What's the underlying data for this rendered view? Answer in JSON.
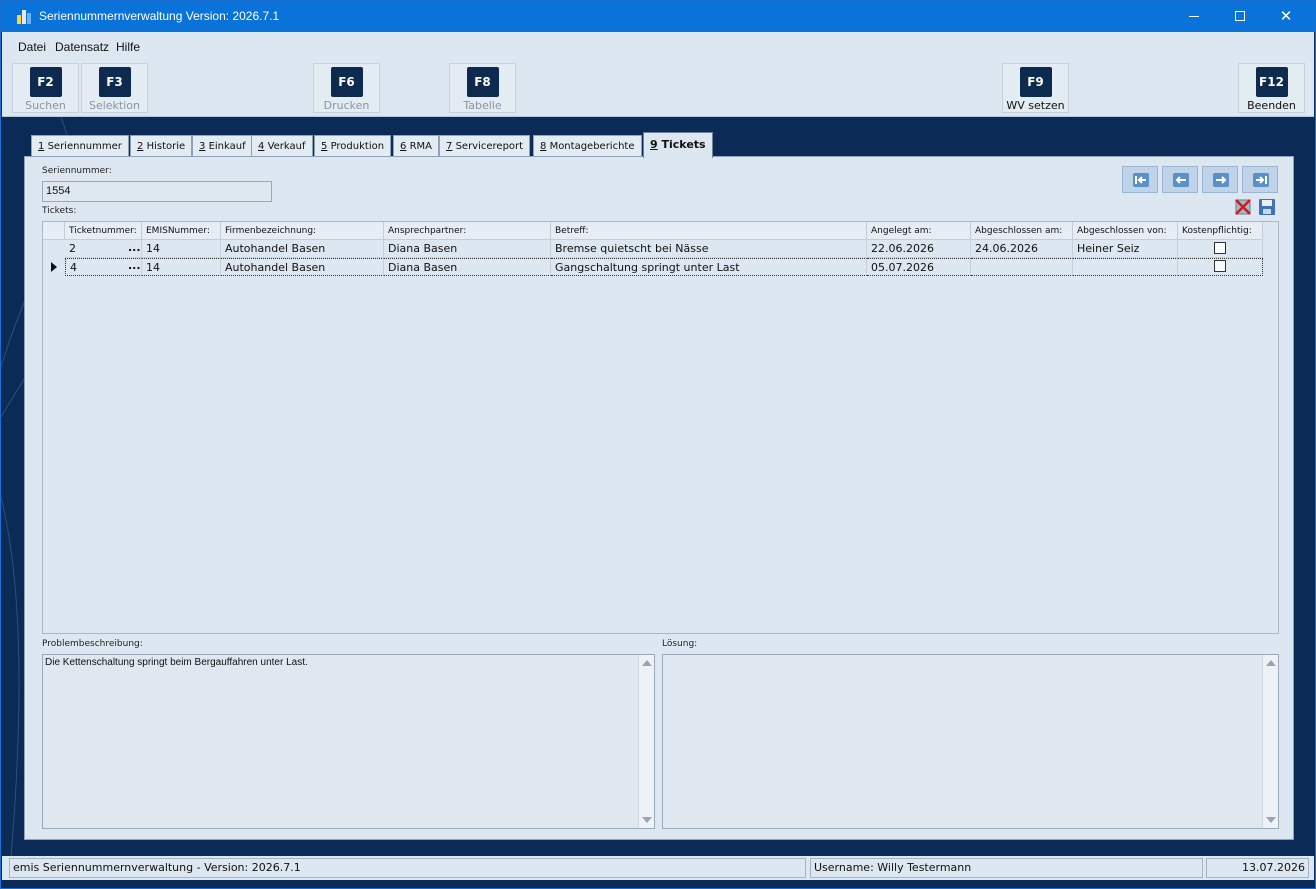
{
  "window": {
    "title": "Seriennummernverwaltung Version: 2026.7.1",
    "icon": "app-chart-icon"
  },
  "menu": [
    "Datei",
    "Datensatz",
    "Hilfe"
  ],
  "toolbar": [
    {
      "key": "F2",
      "label": "Suchen",
      "enabled": false
    },
    {
      "key": "F3",
      "label": "Selektion",
      "enabled": false
    },
    {
      "key": "F6",
      "label": "Drucken",
      "enabled": false
    },
    {
      "key": "F8",
      "label": "Tabelle",
      "enabled": false
    },
    {
      "key": "F9",
      "label": "WV setzen",
      "enabled": true
    },
    {
      "key": "F12",
      "label": "Beenden",
      "enabled": true
    }
  ],
  "tabs": [
    {
      "num": "1",
      "label": "Seriennummer"
    },
    {
      "num": "2",
      "label": "Historie"
    },
    {
      "num": "3",
      "label": "Einkauf"
    },
    {
      "num": "4",
      "label": "Verkauf"
    },
    {
      "num": "5",
      "label": "Produktion"
    },
    {
      "num": "6",
      "label": "RMA"
    },
    {
      "num": "7",
      "label": "Servicereport"
    },
    {
      "num": "8",
      "label": "Montageberichte"
    },
    {
      "num": "9",
      "label": "Tickets",
      "active": true
    }
  ],
  "form": {
    "seriennummer_label": "Seriennummer:",
    "seriennummer_value": "1554",
    "tickets_label": "Tickets:"
  },
  "grid": {
    "columns": [
      "Ticketnummer:",
      "EMISNummer:",
      "Firmenbezeichnung:",
      "Ansprechpartner:",
      "Betreff:",
      "Angelegt am:",
      "Abgeschlossen am:",
      "Abgeschlossen von:",
      "Kostenpflichtig:"
    ],
    "rows": [
      {
        "ticketnummer": "2",
        "emisnummer": "14",
        "firma": "Autohandel Basen",
        "ansprechpartner": "Diana Basen",
        "betreff": "Bremse quietscht bei Nässe",
        "angelegt": "22.06.2026",
        "abgeschlossen_am": "24.06.2026",
        "abgeschlossen_von": "Heiner Seiz",
        "kostenpflichtig": false
      },
      {
        "ticketnummer": "4",
        "emisnummer": "14",
        "firma": "Autohandel Basen",
        "ansprechpartner": "Diana Basen",
        "betreff": "Gangschaltung springt unter Last",
        "angelegt": "05.07.2026",
        "abgeschlossen_am": "",
        "abgeschlossen_von": "",
        "kostenpflichtig": false,
        "selected": true
      }
    ]
  },
  "problem": {
    "label": "Problembeschreibung:",
    "text": "Die Kettenschaltung springt beim Bergauffahren unter Last."
  },
  "loesung": {
    "label": "Lösung:",
    "text": ""
  },
  "statusbar": {
    "app": "emis Seriennummernverwaltung - Version: 2026.7.1",
    "user": "Username: Willy Testermann",
    "date": "13.07.2026"
  }
}
